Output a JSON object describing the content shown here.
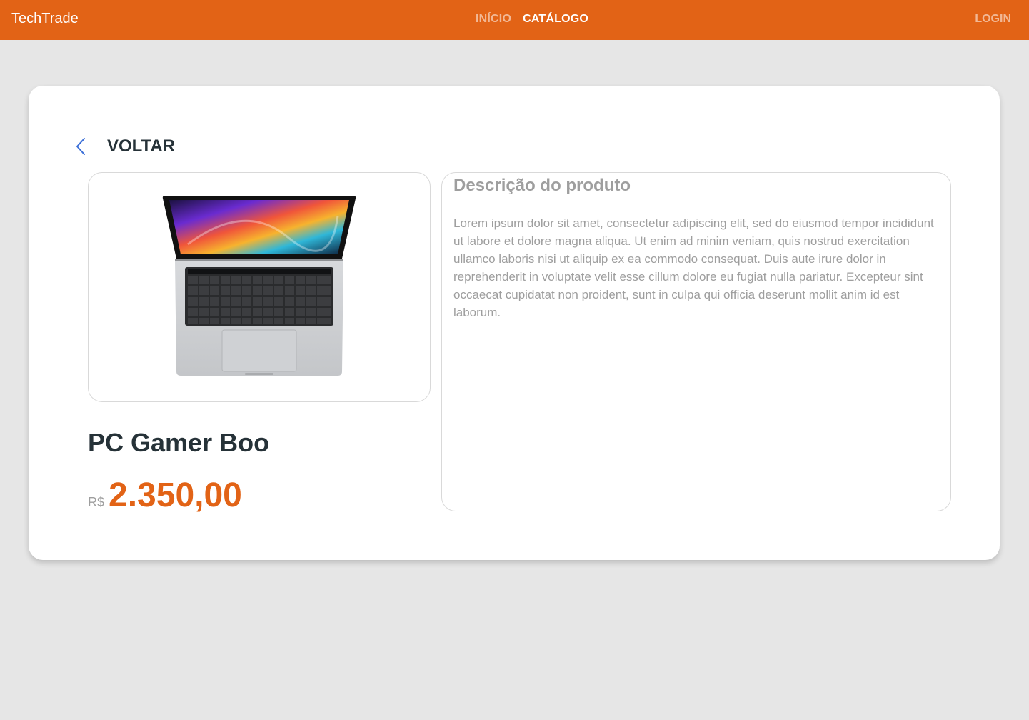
{
  "navbar": {
    "brand": "TechTrade",
    "links": [
      "INÍCIO",
      "CATÁLOGO"
    ],
    "active_link": "CATÁLOGO",
    "login": "LOGIN",
    "color": "#e26316"
  },
  "back": {
    "label": "VOLTAR",
    "icon": "chevron-left-icon",
    "icon_color": "#3b6fd8"
  },
  "product": {
    "image_icon": "laptop-icon",
    "name": "PC Gamer Boo",
    "currency": "R$",
    "price": "2.350,00",
    "price_color": "#e26316"
  },
  "description": {
    "title": "Descrição do produto",
    "text": "Lorem ipsum dolor sit amet, consectetur adipiscing elit, sed do eiusmod tempor incididunt ut labore et dolore magna aliqua. Ut enim ad minim veniam, quis nostrud exercitation ullamco laboris nisi ut aliquip ex ea commodo consequat. Duis aute irure dolor in reprehenderit in voluptate velit esse cillum dolore eu fugiat nulla pariatur. Excepteur sint occaecat cupidatat non proident, sunt in culpa qui officia deserunt mollit anim id est laborum."
  }
}
